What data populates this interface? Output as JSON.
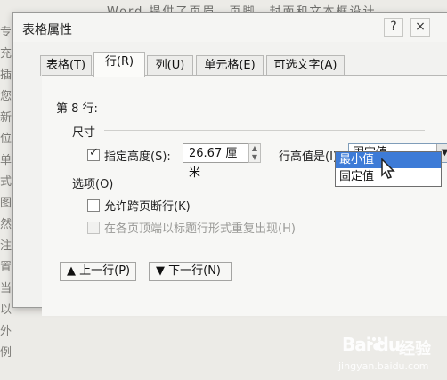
{
  "document_strip": [
    "专",
    "充",
    "插",
    "您",
    "新",
    "位",
    "单",
    "式",
    "图",
    "然",
    "注",
    "置",
    "当",
    "以",
    "外",
    "例"
  ],
  "top_text": "Word 提供了页眉、页脚、封面和文本框设计",
  "dialog": {
    "title": "表格属性",
    "help_icon": "help-icon",
    "close_icon": "close-icon",
    "tabs": [
      {
        "label": "表格(T)"
      },
      {
        "label": "行(R)"
      },
      {
        "label": "列(U)"
      },
      {
        "label": "单元格(E)"
      },
      {
        "label": "可选文字(A)"
      }
    ],
    "row_label": "第 8 行:",
    "size_section": "尺寸",
    "specify_height_label": "指定高度(S):",
    "height_value": "26.67 厘米",
    "row_height_is_label": "行高值是(I):",
    "row_height_mode": "固定值",
    "dropdown_options": [
      "最小值",
      "固定值"
    ],
    "options_section": "选项(O)",
    "allow_break_label": "允许跨页断行(K)",
    "repeat_header_label": "在各页顶端以标题行形式重复出现(H)",
    "prev_row_label": "上一行(P)",
    "next_row_label": "下一行(N)"
  },
  "watermark": {
    "logo": "Bai du",
    "cn": "经验",
    "url": "jingyan.baidu.com"
  }
}
